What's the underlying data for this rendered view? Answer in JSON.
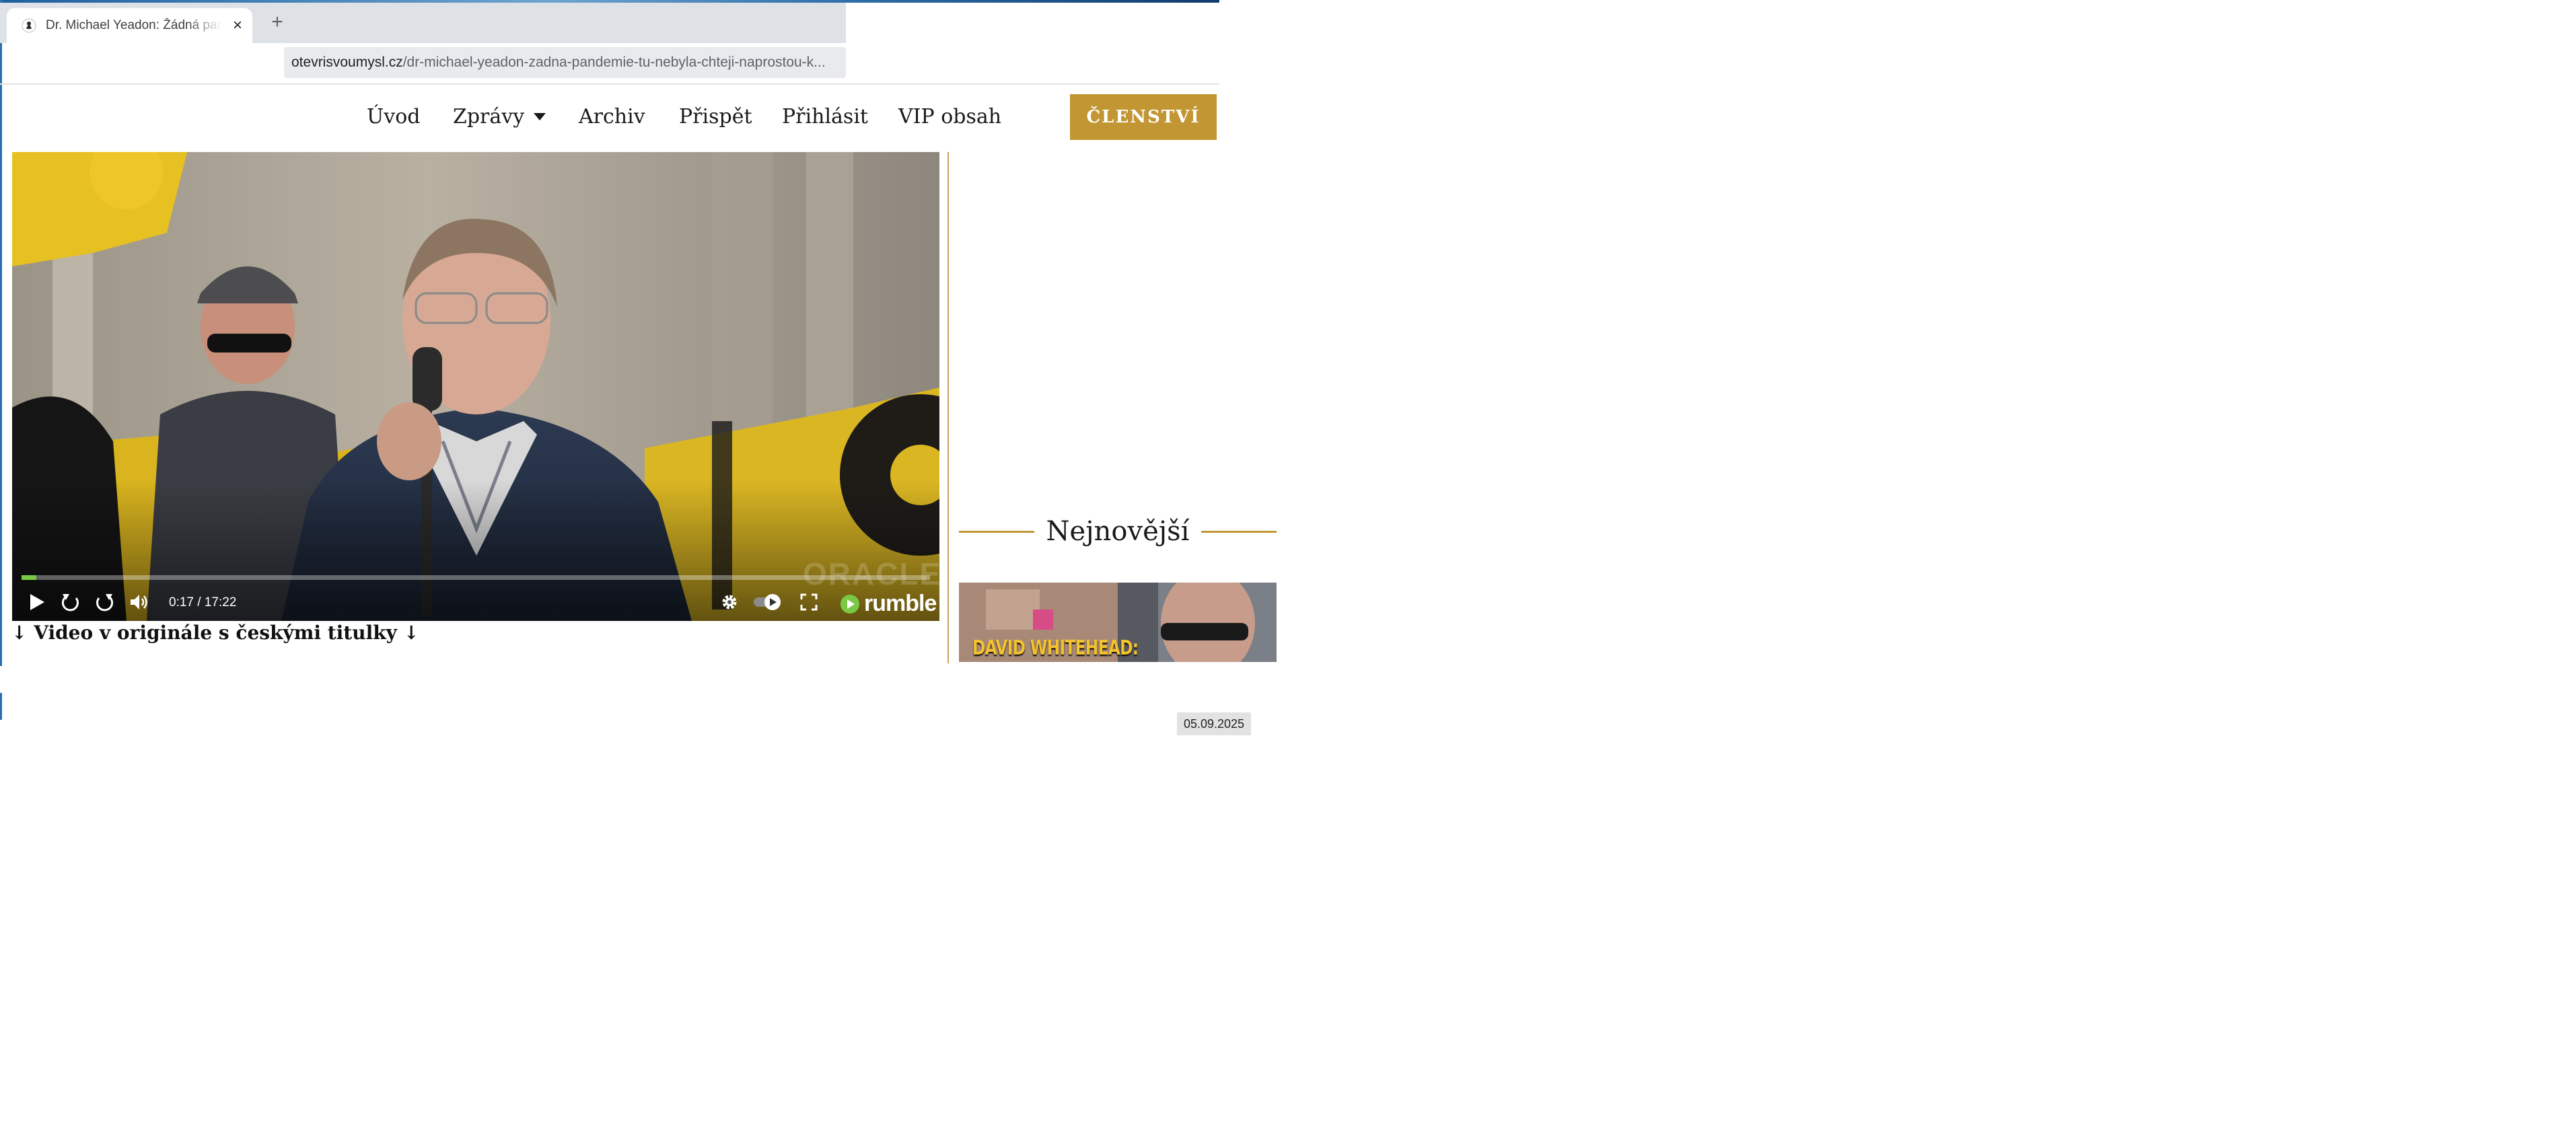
{
  "browser": {
    "tab_title": "Dr. Michael Yeadon: Žádná pandemie tu nebyla, chtěji naprostou kontrolu",
    "url_host": "otevrisvoumysl.cz",
    "url_path": "/dr-michael-yeadon-zadna-pandemie-tu-nebyla-chteji-naprostou-k...",
    "new_tab_symbol": "+",
    "close_symbol": "×"
  },
  "nav": {
    "items": [
      {
        "label": "Úvod"
      },
      {
        "label": "Zprávy",
        "has_dropdown": true
      },
      {
        "label": "Archiv"
      },
      {
        "label": "Přispět"
      },
      {
        "label": "Přihlásit"
      },
      {
        "label": "VIP obsah"
      }
    ],
    "member_button": "ČLENSTVÍ",
    "accent_color": "#c19633"
  },
  "video": {
    "time": "0:17 / 17:22",
    "progress_fraction": 0.016,
    "progress_color": "#7ac944",
    "watermark": "ORACLE",
    "brand": "rumble",
    "icons": [
      "play-icon",
      "rewind-icon",
      "forward-icon",
      "volume-icon",
      "settings-icon",
      "autoplay-toggle-icon",
      "fullscreen-icon",
      "rumble-logo-icon"
    ]
  },
  "caption": "↓ Video v originále s českými titulky ↓",
  "sidebar": {
    "heading": "Nejnovější",
    "thumb_text": "DAVID WHITEHEAD:",
    "date": "05.09.2025"
  }
}
